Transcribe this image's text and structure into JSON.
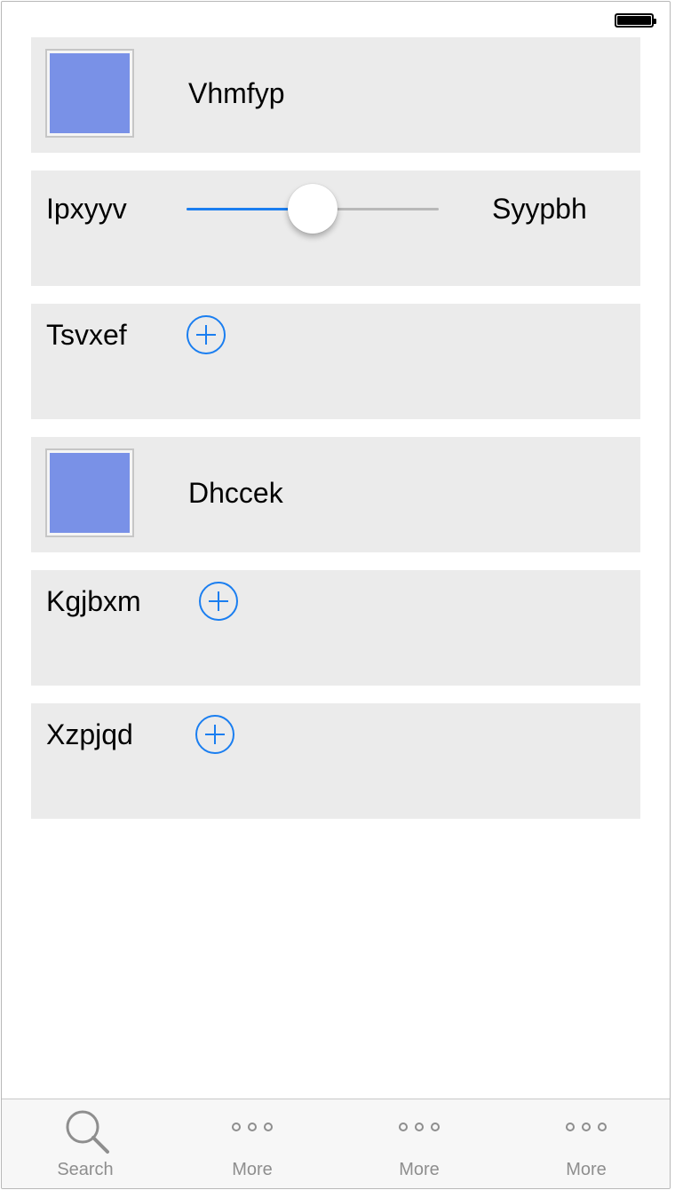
{
  "theme": {
    "accent": "#1a7ef0",
    "swatch": "#7991e7",
    "row_bg": "#ebebeb",
    "tab_inactive": "#8e8e8e"
  },
  "status_bar": {
    "battery_icon": "battery-full-icon"
  },
  "rows": [
    {
      "type": "image",
      "label": "Vhmfyp",
      "swatch_color": "#7991e7"
    },
    {
      "type": "slider",
      "left_label": "Ipxyyv",
      "right_label": "Syypbh",
      "value": 0.5
    },
    {
      "type": "add",
      "label": "Tsvxef",
      "icon": "plus-circle-icon"
    },
    {
      "type": "image",
      "label": "Dhccek",
      "swatch_color": "#7991e7"
    },
    {
      "type": "add",
      "label": "Kgjbxm",
      "icon": "plus-circle-icon"
    },
    {
      "type": "add",
      "label": "Xzpjqd",
      "icon": "plus-circle-icon"
    }
  ],
  "tab_bar": {
    "tabs": [
      {
        "label": "Search",
        "icon": "search-icon"
      },
      {
        "label": "More",
        "icon": "more-icon"
      },
      {
        "label": "More",
        "icon": "more-icon"
      },
      {
        "label": "More",
        "icon": "more-icon"
      }
    ]
  }
}
